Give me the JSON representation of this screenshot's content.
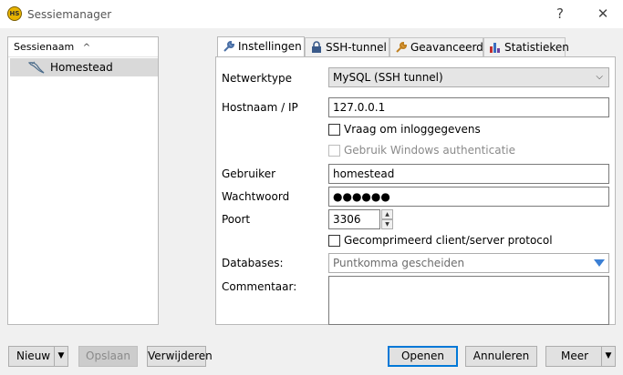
{
  "window": {
    "title": "Sessiemanager",
    "app_icon_text": "HS",
    "help_glyph": "?",
    "close_glyph": "✕"
  },
  "sessions": {
    "header": "Sessienaam",
    "sort_glyph": "^",
    "items": [
      {
        "label": "Homestead",
        "icon": "mysql-dolphin-icon"
      }
    ]
  },
  "tabs": [
    {
      "label": "Instellingen",
      "icon": "wrench-icon",
      "active": true
    },
    {
      "label": "SSH-tunnel",
      "icon": "lock-icon",
      "active": false
    },
    {
      "label": "Geavanceerd",
      "icon": "wrench-icon",
      "active": false
    },
    {
      "label": "Statistieken",
      "icon": "bar-chart-icon",
      "active": false
    }
  ],
  "form": {
    "network_type_label": "Netwerktype",
    "network_type_value": "MySQL (SSH tunnel)",
    "hostname_label": "Hostnaam / IP",
    "hostname_value": "127.0.0.1",
    "prompt_login_label": "Vraag om inloggegevens",
    "prompt_login_checked": false,
    "windows_auth_label": "Gebruik Windows authenticatie",
    "windows_auth_checked": false,
    "user_label": "Gebruiker",
    "user_value": "homestead",
    "password_label": "Wachtwoord",
    "password_value": "●●●●●●",
    "port_label": "Poort",
    "port_value": "3306",
    "compressed_label": "Gecomprimeerd client/server protocol",
    "compressed_checked": false,
    "databases_label": "Databases:",
    "databases_placeholder": "Puntkomma gescheiden",
    "comment_label": "Commentaar:",
    "comment_value": ""
  },
  "buttons": {
    "new": "Nieuw",
    "save": "Opslaan",
    "delete": "Verwijderen",
    "open": "Openen",
    "cancel": "Annuleren",
    "more": "Meer",
    "dropdown_glyph": "▼"
  },
  "colors": {
    "accent": "#0078d7",
    "selection": "#d9d9d9",
    "dropdown_arrow": "#3b7fd4"
  }
}
